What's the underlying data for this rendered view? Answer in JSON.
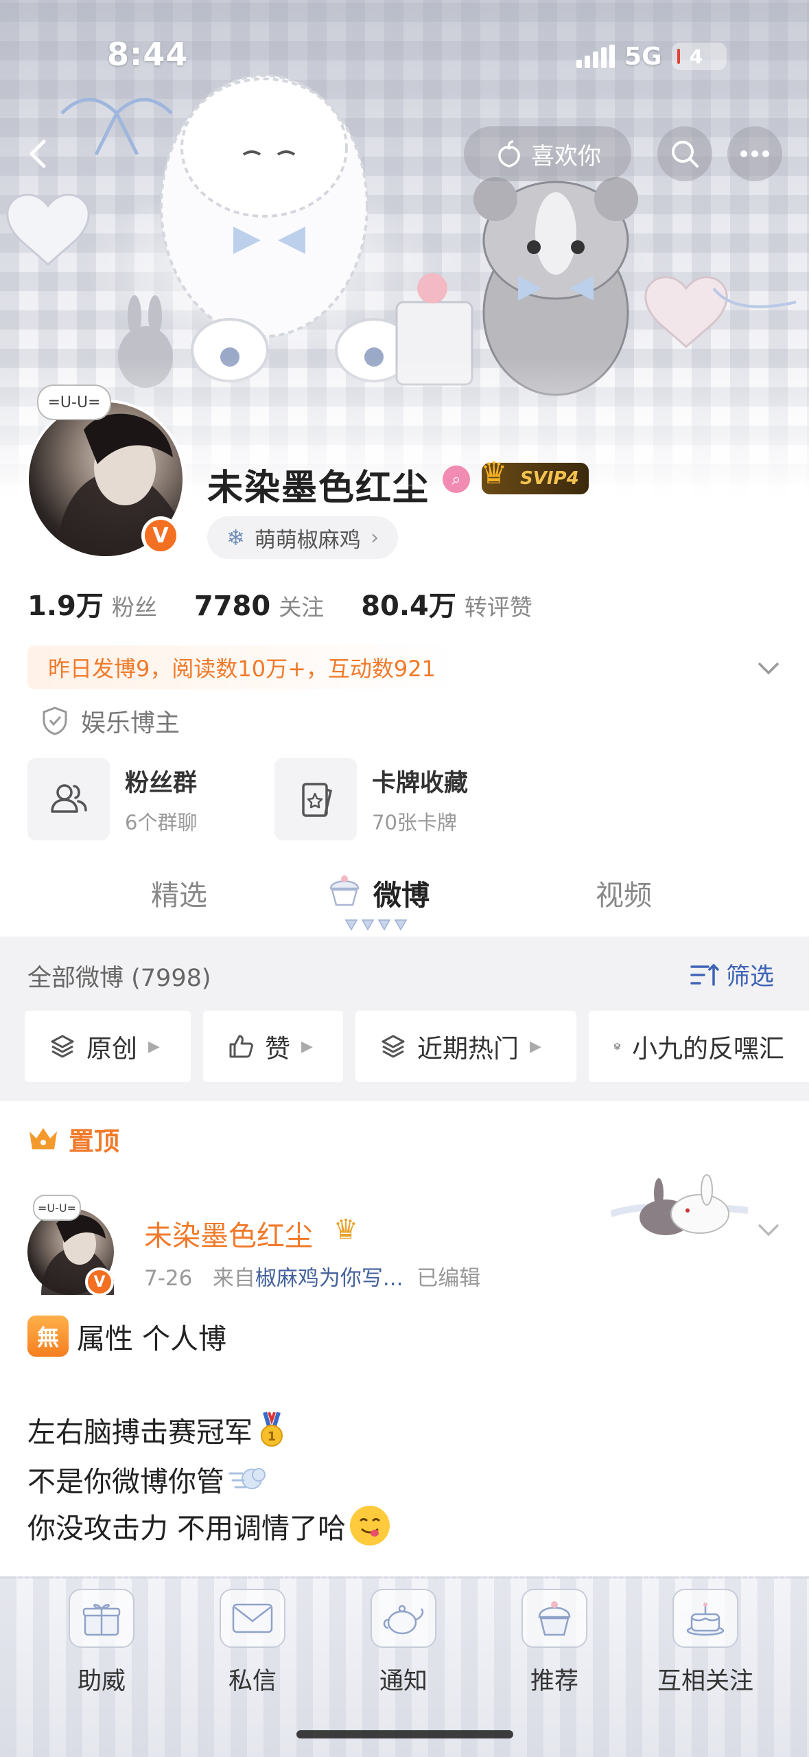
{
  "status_bar": {
    "time": "8:44",
    "network": "5G",
    "battery": "4"
  },
  "header": {
    "like_label": "喜欢你"
  },
  "profile": {
    "avatar_tag": "=U-U=",
    "username": "未染墨色红尘",
    "vip_badge": "SVIP4",
    "group": "萌萌椒麻鸡",
    "stats": [
      {
        "value": "1.9万",
        "label": "粉丝"
      },
      {
        "value": "7780",
        "label": "关注"
      },
      {
        "value": "80.4万",
        "label": "转评赞"
      }
    ],
    "summary": "昨日发博9，阅读数10万+，互动数921",
    "role": "娱乐博主",
    "cards": [
      {
        "title": "粉丝群",
        "subtitle": "6个群聊"
      },
      {
        "title": "卡牌收藏",
        "subtitle": "70张卡牌"
      }
    ]
  },
  "tabs": [
    {
      "label": "精选",
      "active": false
    },
    {
      "label": "微博",
      "active": true
    },
    {
      "label": "视频",
      "active": false
    }
  ],
  "feed": {
    "all_label": "全部微博 (7998)",
    "filter_label": "筛选",
    "chips": [
      "原创",
      "赞",
      "近期热门",
      "小九的反嘿汇"
    ]
  },
  "post": {
    "pinned_label": "置顶",
    "author": "未染墨色红尘",
    "date": "7-26",
    "source_prefix": "来自",
    "source": "椒麻鸡为你写...",
    "edited": "已编辑",
    "badge_char": "無",
    "lines": [
      "属性 个人博",
      "左右脑搏击赛冠军",
      "不是你微博你管",
      "你没攻击力 不用调情了哈"
    ]
  },
  "bottom_bar": [
    "助威",
    "私信",
    "通知",
    "推荐",
    "互相关注"
  ],
  "colors": {
    "accent_orange": "#f07a2a",
    "link_blue": "#3e63b6",
    "verify_orange": "#f36f21"
  }
}
